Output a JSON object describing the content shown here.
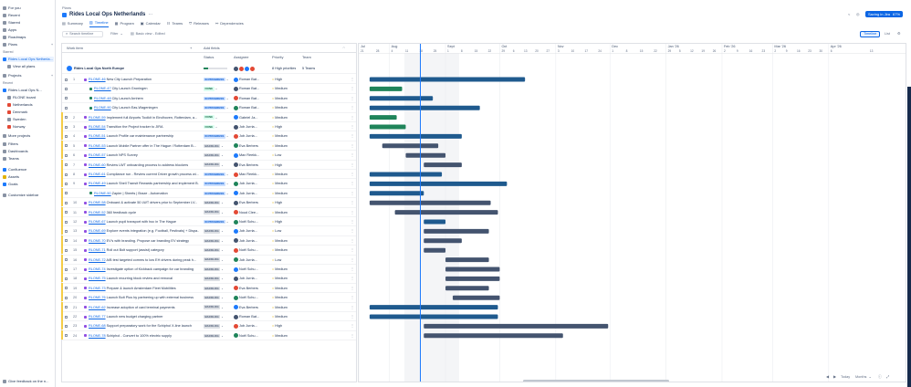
{
  "sidebar": {
    "for_you": "For you",
    "recent": "Recent",
    "starred": "Starred",
    "apps": "Apps",
    "roadmaps": "Roadmaps",
    "plans": "Plans",
    "starred_section": "Starred",
    "starred_plan": "Rides Local Ops Netherla...",
    "view_all_plans": "View all plans",
    "projects": "Projects",
    "recent_section": "Recent",
    "recent_project": "Rides Local Ops N...",
    "board": "RLONE board",
    "netherlands": "Netherlands",
    "denmark": "Denmark",
    "sweden": "Sweden",
    "norway": "Norway",
    "more_projects": "More projects",
    "filters": "Filters",
    "dashboards": "Dashboards",
    "teams": "Teams",
    "confluence": "Confluence",
    "assets": "Assets",
    "goals": "Goals",
    "customize": "Customize sidebar",
    "feedback": "Give feedback on the n..."
  },
  "header": {
    "breadcrumb": "Plans",
    "title": "Rides Local Ops Netherlands",
    "more": "···",
    "promo": "Saving in Jira",
    "promo_pct": "67%",
    "tabs": [
      {
        "label": "Summary"
      },
      {
        "label": "Timeline"
      },
      {
        "label": "Program"
      },
      {
        "label": "Calendar"
      },
      {
        "label": "Teams"
      },
      {
        "label": "Releases"
      },
      {
        "label": "Dependencies"
      }
    ]
  },
  "toolbar": {
    "search_placeholder": "Search timeline",
    "filter": "Filter",
    "view": "Basic view - Edited",
    "timeline_btn": "Timeline",
    "list_btn": "List"
  },
  "grid": {
    "col_work": "Work item",
    "col_fields": "Add fields",
    "col_status": "Status",
    "col_assignee": "Assignee",
    "col_priority": "Priority",
    "col_team": "Team",
    "parent": {
      "name": "Rides Local Ops North Europe",
      "priority": "8 High priorities",
      "team": "5 Teams"
    },
    "rows": [
      {
        "n": "1",
        "key": "RLONE-46",
        "title": "New City Launch Preparation",
        "status": "IN PROGRESS",
        "assignee": "Roman Bat...",
        "priority": "High"
      },
      {
        "n": "",
        "key": "RLONE-47",
        "title": "City Launch Groningen",
        "status": "DONE",
        "assignee": "Roman Bat...",
        "priority": "Medium"
      },
      {
        "n": "",
        "key": "RLONE-48",
        "title": "City Launch Arnhem",
        "status": "IN PROGRESS",
        "assignee": "Roman Bat...",
        "priority": "Medium"
      },
      {
        "n": "",
        "key": "RLONE-90",
        "title": "City Launch Eas-Wageningen",
        "status": "IN PROGRESS",
        "assignee": "Roman Bat...",
        "priority": "Medium"
      },
      {
        "n": "2",
        "key": "RLONE-59",
        "title": "Implement full Airports Toolkit in Eindhoven, Rotterdam, a...",
        "status": "DONE",
        "assignee": "Gabriel Ja...",
        "priority": "Medium"
      },
      {
        "n": "3",
        "key": "RLONE-54",
        "title": "Transition the Project tracker to JIRA",
        "status": "DONE",
        "assignee": "Job Jurria...",
        "priority": "High"
      },
      {
        "n": "4",
        "key": "RLONE-51",
        "title": "Launch Profile car maintenance partnership",
        "status": "IN PROGRESS",
        "assignee": "Job Jurria...",
        "priority": "Medium"
      },
      {
        "n": "5",
        "key": "RLONE-53",
        "title": "Launch Mobile Partner offer in The Hague / Rotterdam B...",
        "status": "BACKLOG",
        "assignee": "Eva Berbers",
        "priority": "Medium"
      },
      {
        "n": "6",
        "key": "RLONE-57",
        "title": "Launch NPS Survey",
        "status": "BACKLOG",
        "assignee": "Max Reekk...",
        "priority": "Low"
      },
      {
        "n": "7",
        "key": "RLONE-60",
        "title": "Review LWT onboarding process to address blockers",
        "status": "BACKLOG",
        "assignee": "Eva Berbers",
        "priority": "High"
      },
      {
        "n": "8",
        "key": "RLONE-61",
        "title": "Compliance run - Review current Driver growth process wi...",
        "status": "IN PROGRESS",
        "assignee": "Max Reekk...",
        "priority": "Medium"
      },
      {
        "n": "9",
        "key": "RLONE-49",
        "title": "Launch Shell Transit Rewards partnership and implement B...",
        "status": "IN PROGRESS",
        "assignee": "Job Jurria...",
        "priority": "Medium"
      },
      {
        "n": "",
        "key": "RLONE-50",
        "title": "Zapier | Sheets | Braze - Automation",
        "status": "IN PROGRESS",
        "assignee": "Job Jurria...",
        "priority": "Medium"
      },
      {
        "n": "10",
        "key": "RLONE-58",
        "title": "Onboard & activate 50 LWT drivers prior to September LV...",
        "status": "BACKLOG",
        "assignee": "Eva Berbers",
        "priority": "High"
      },
      {
        "n": "11",
        "key": "RLONE-52",
        "title": "360 feedback cycle",
        "status": "BACKLOG",
        "assignee": "Noud Clee...",
        "priority": "Medium"
      },
      {
        "n": "12",
        "key": "RLONE-67",
        "title": "Launch pupil transport with hoc in The Hague",
        "status": "IN PROGRESS",
        "assignee": "Noël Schu...",
        "priority": "High"
      },
      {
        "n": "13",
        "key": "RLONE-69",
        "title": "Explore events integration (e.g. Football, Festivals) + Dispa...",
        "status": "BACKLOG",
        "assignee": "Job Jurria...",
        "priority": "Low"
      },
      {
        "n": "14",
        "key": "RLONE-70",
        "title": "EV's with branding. Propose car branding EV strategy",
        "status": "BACKLOG",
        "assignee": "Job Jurria...",
        "priority": "Medium"
      },
      {
        "n": "15",
        "key": "RLONE-71",
        "title": "Roll out Bolt support (assist) category",
        "status": "BACKLOG",
        "assignee": "Noël Schu...",
        "priority": "Medium"
      },
      {
        "n": "16",
        "key": "RLONE-72",
        "title": "A/B test targeted comms to low EH drivers during peak h...",
        "status": "BACKLOG",
        "assignee": "Job Jurria...",
        "priority": "Low"
      },
      {
        "n": "17",
        "key": "RLONE-74",
        "title": "Investigate option of Kickback campaign for car branding",
        "status": "BACKLOG",
        "assignee": "Noël Schu...",
        "priority": "Medium"
      },
      {
        "n": "18",
        "key": "RLONE-75",
        "title": "Launch recurring block review and removal",
        "status": "BACKLOG",
        "assignee": "Job Jurria...",
        "priority": "Medium"
      },
      {
        "n": "19",
        "key": "RLONE-73",
        "title": "Prepare & launch Amsterdam Fleet Mobilities",
        "status": "BACKLOG",
        "assignee": "Eva Berbers",
        "priority": "Medium"
      },
      {
        "n": "20",
        "key": "RLONE-76",
        "title": "Launch Bolt Plus by partnering up with external business",
        "status": "BACKLOG",
        "assignee": "Noël Schu...",
        "priority": "Medium"
      },
      {
        "n": "21",
        "key": "RLONE-62",
        "title": "Increase adoption of card terminal payments",
        "status": "BACKLOG",
        "assignee": "Eva Berbers",
        "priority": "Medium"
      },
      {
        "n": "22",
        "key": "RLONE-77",
        "title": "Launch new budget charging partner",
        "status": "BACKLOG",
        "assignee": "Roman Bat...",
        "priority": "Medium"
      },
      {
        "n": "23",
        "key": "RLONE-68",
        "title": "Support preparatory work for the Schiphol X-line launch",
        "status": "BACKLOG",
        "assignee": "Job Jurria...",
        "priority": "High"
      },
      {
        "n": "24",
        "key": "RLONE-78",
        "title": "Schiphol - Convert to 100% electric supply",
        "status": "BACKLOG",
        "assignee": "Noël Schu...",
        "priority": "Medium"
      }
    ]
  },
  "timeline": {
    "months": [
      {
        "label": "Jul",
        "d": [
          "21",
          "28"
        ]
      },
      {
        "label": "Aug",
        "d": [
          "4",
          "11",
          "18",
          "25"
        ]
      },
      {
        "label": "Sept",
        "d": [
          "1",
          "8",
          "15",
          "22"
        ]
      },
      {
        "label": "Oct",
        "d": [
          "29",
          "6",
          "13",
          "20",
          "27"
        ]
      },
      {
        "label": "Nov",
        "d": [
          "3",
          "10",
          "17",
          "24"
        ]
      },
      {
        "label": "Dec",
        "d": [
          "1",
          "8",
          "15",
          "22"
        ]
      },
      {
        "label": "Jan '26",
        "d": [
          "29",
          "5",
          "12",
          "19",
          "26"
        ]
      },
      {
        "label": "Feb '26",
        "d": [
          "2",
          "9",
          "16",
          "23"
        ]
      },
      {
        "label": "Mar '26",
        "d": [
          "2",
          "9",
          "16",
          "23",
          "30"
        ]
      },
      {
        "label": "Apr '26",
        "d": [
          "6",
          "13"
        ]
      }
    ],
    "today_btn": "Today",
    "scale_btn": "Months",
    "bars": [
      {
        "start": "2025-07-21",
        "end": "2025-10-15",
        "color": "#1f5a8e"
      },
      {
        "start": "2025-07-21",
        "end": "2025-08-08",
        "color": "#1f845a"
      },
      {
        "start": "2025-07-21",
        "end": "2025-08-25",
        "color": "#1f5a8e"
      },
      {
        "start": "2025-07-21",
        "end": "2025-09-20",
        "color": "#1f5a8e"
      },
      {
        "start": "2025-07-21",
        "end": "2025-08-05",
        "color": "#1f845a"
      },
      {
        "start": "2025-07-21",
        "end": "2025-08-10",
        "color": "#1f845a"
      },
      {
        "start": "2025-07-21",
        "end": "2025-09-10",
        "color": "#1f5a8e"
      },
      {
        "start": "2025-07-28",
        "end": "2025-08-28",
        "color": "#44546f"
      },
      {
        "start": "2025-08-10",
        "end": "2025-09-01",
        "color": "#44546f"
      },
      {
        "start": "2025-08-20",
        "end": "2025-09-10",
        "color": "#44546f"
      },
      {
        "start": "2025-07-21",
        "end": "2025-08-30",
        "color": "#1f5a8e"
      },
      {
        "start": "2025-07-21",
        "end": "2025-10-05",
        "color": "#1f5a8e"
      },
      {
        "start": "2025-07-21",
        "end": "2025-08-20",
        "color": "#1f5a8e"
      },
      {
        "start": "2025-07-21",
        "end": "2025-09-26",
        "color": "#44546f"
      },
      {
        "start": "2025-08-04",
        "end": "2025-09-30",
        "color": "#44546f"
      },
      {
        "start": "2025-08-20",
        "end": "2025-09-01",
        "color": "#1f5a8e"
      },
      {
        "start": "2025-08-20",
        "end": "2025-09-25",
        "color": "#44546f"
      },
      {
        "start": "2025-08-20",
        "end": "2025-09-10",
        "color": "#44546f"
      },
      {
        "start": "2025-08-20",
        "end": "2025-09-01",
        "color": "#44546f"
      },
      {
        "start": "2025-09-01",
        "end": "2025-09-25",
        "color": "#44546f"
      },
      {
        "start": "2025-09-01",
        "end": "2025-10-01",
        "color": "#44546f"
      },
      {
        "start": "2025-09-01",
        "end": "2025-10-01",
        "color": "#44546f"
      },
      {
        "start": "2025-09-01",
        "end": "2025-09-25",
        "color": "#44546f"
      },
      {
        "start": "2025-09-05",
        "end": "2025-10-01",
        "color": "#44546f"
      },
      {
        "start": "2025-07-21",
        "end": "2025-09-30",
        "color": "#1f5a8e"
      },
      {
        "start": "2025-07-21",
        "end": "2025-09-30",
        "color": "#1f5a8e"
      },
      {
        "start": "2025-08-20",
        "end": "2025-11-30",
        "color": "#44546f"
      },
      {
        "start": "2025-08-20",
        "end": "2025-11-05",
        "color": "#44546f"
      }
    ]
  }
}
